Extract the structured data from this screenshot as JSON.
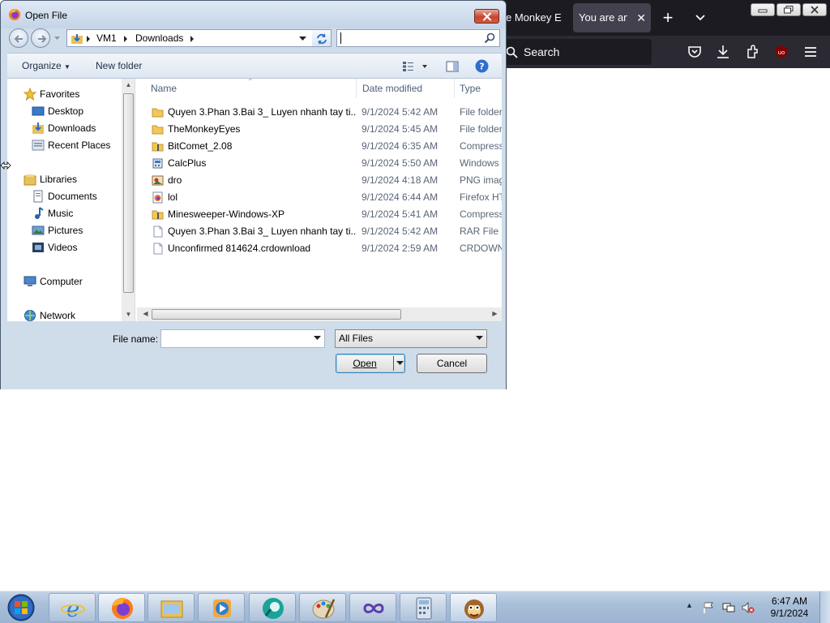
{
  "firefox": {
    "tabs": [
      {
        "label": "e Monkey E",
        "active": false
      },
      {
        "label": "You are an i",
        "active": true
      }
    ],
    "search_placeholder": "Search",
    "toolbar_icons": [
      "pocket-icon",
      "download-icon",
      "extensions-icon",
      "ublock-icon",
      "menu-icon"
    ],
    "ublock_badge": "uo"
  },
  "dialog": {
    "title": "Open File",
    "breadcrumb": [
      "VM1",
      "Downloads"
    ],
    "search_value": "",
    "commands": {
      "organize": "Organize",
      "new_folder": "New folder"
    },
    "nav": {
      "favorites": "Favorites",
      "desktop": "Desktop",
      "downloads": "Downloads",
      "recent": "Recent Places",
      "libraries": "Libraries",
      "documents": "Documents",
      "music": "Music",
      "pictures": "Pictures",
      "videos": "Videos",
      "computer": "Computer",
      "network": "Network"
    },
    "columns": {
      "name": "Name",
      "date": "Date modified",
      "type": "Type"
    },
    "files": [
      {
        "name": "Quyen 3.Phan 3.Bai 3_ Luyen nhanh tay ti...",
        "date": "9/1/2024 5:42 AM",
        "type": "File folder",
        "icon": "folder"
      },
      {
        "name": "TheMonkeyEyes",
        "date": "9/1/2024 5:45 AM",
        "type": "File folder",
        "icon": "folder"
      },
      {
        "name": "BitComet_2.08",
        "date": "9/1/2024 6:35 AM",
        "type": "Compressed",
        "icon": "zip-folder"
      },
      {
        "name": "CalcPlus",
        "date": "9/1/2024 5:50 AM",
        "type": "Windows",
        "icon": "installer"
      },
      {
        "name": "dro",
        "date": "9/1/2024 4:18 AM",
        "type": "PNG image",
        "icon": "image"
      },
      {
        "name": "lol",
        "date": "9/1/2024 6:44 AM",
        "type": "Firefox HTML",
        "icon": "html"
      },
      {
        "name": "Minesweeper-Windows-XP",
        "date": "9/1/2024 5:41 AM",
        "type": "Compressed",
        "icon": "zip-folder"
      },
      {
        "name": "Quyen 3.Phan 3.Bai 3_ Luyen nhanh tay ti...",
        "date": "9/1/2024 5:42 AM",
        "type": "RAR File",
        "icon": "file"
      },
      {
        "name": "Unconfirmed 814624.crdownload",
        "date": "9/1/2024 2:59 AM",
        "type": "CRDOWNLOAD",
        "icon": "file"
      }
    ],
    "file_name_label": "File name:",
    "file_name_value": "",
    "file_type": "All Files",
    "open_label": "Open",
    "cancel_label": "Cancel"
  },
  "taskbar": {
    "apps": [
      "internet-explorer",
      "firefox",
      "file-explorer",
      "media-player",
      "app-teal",
      "paint",
      "visual-studio",
      "calculator",
      "monkey-app"
    ],
    "time": "6:47 AM",
    "date": "9/1/2024"
  },
  "colors": {
    "firefox_dark": "#1c1b22",
    "firefox_toolbar": "#2b2a33",
    "dialog_frame": "#cfdcea",
    "taskbar": "#a9bfd9"
  }
}
